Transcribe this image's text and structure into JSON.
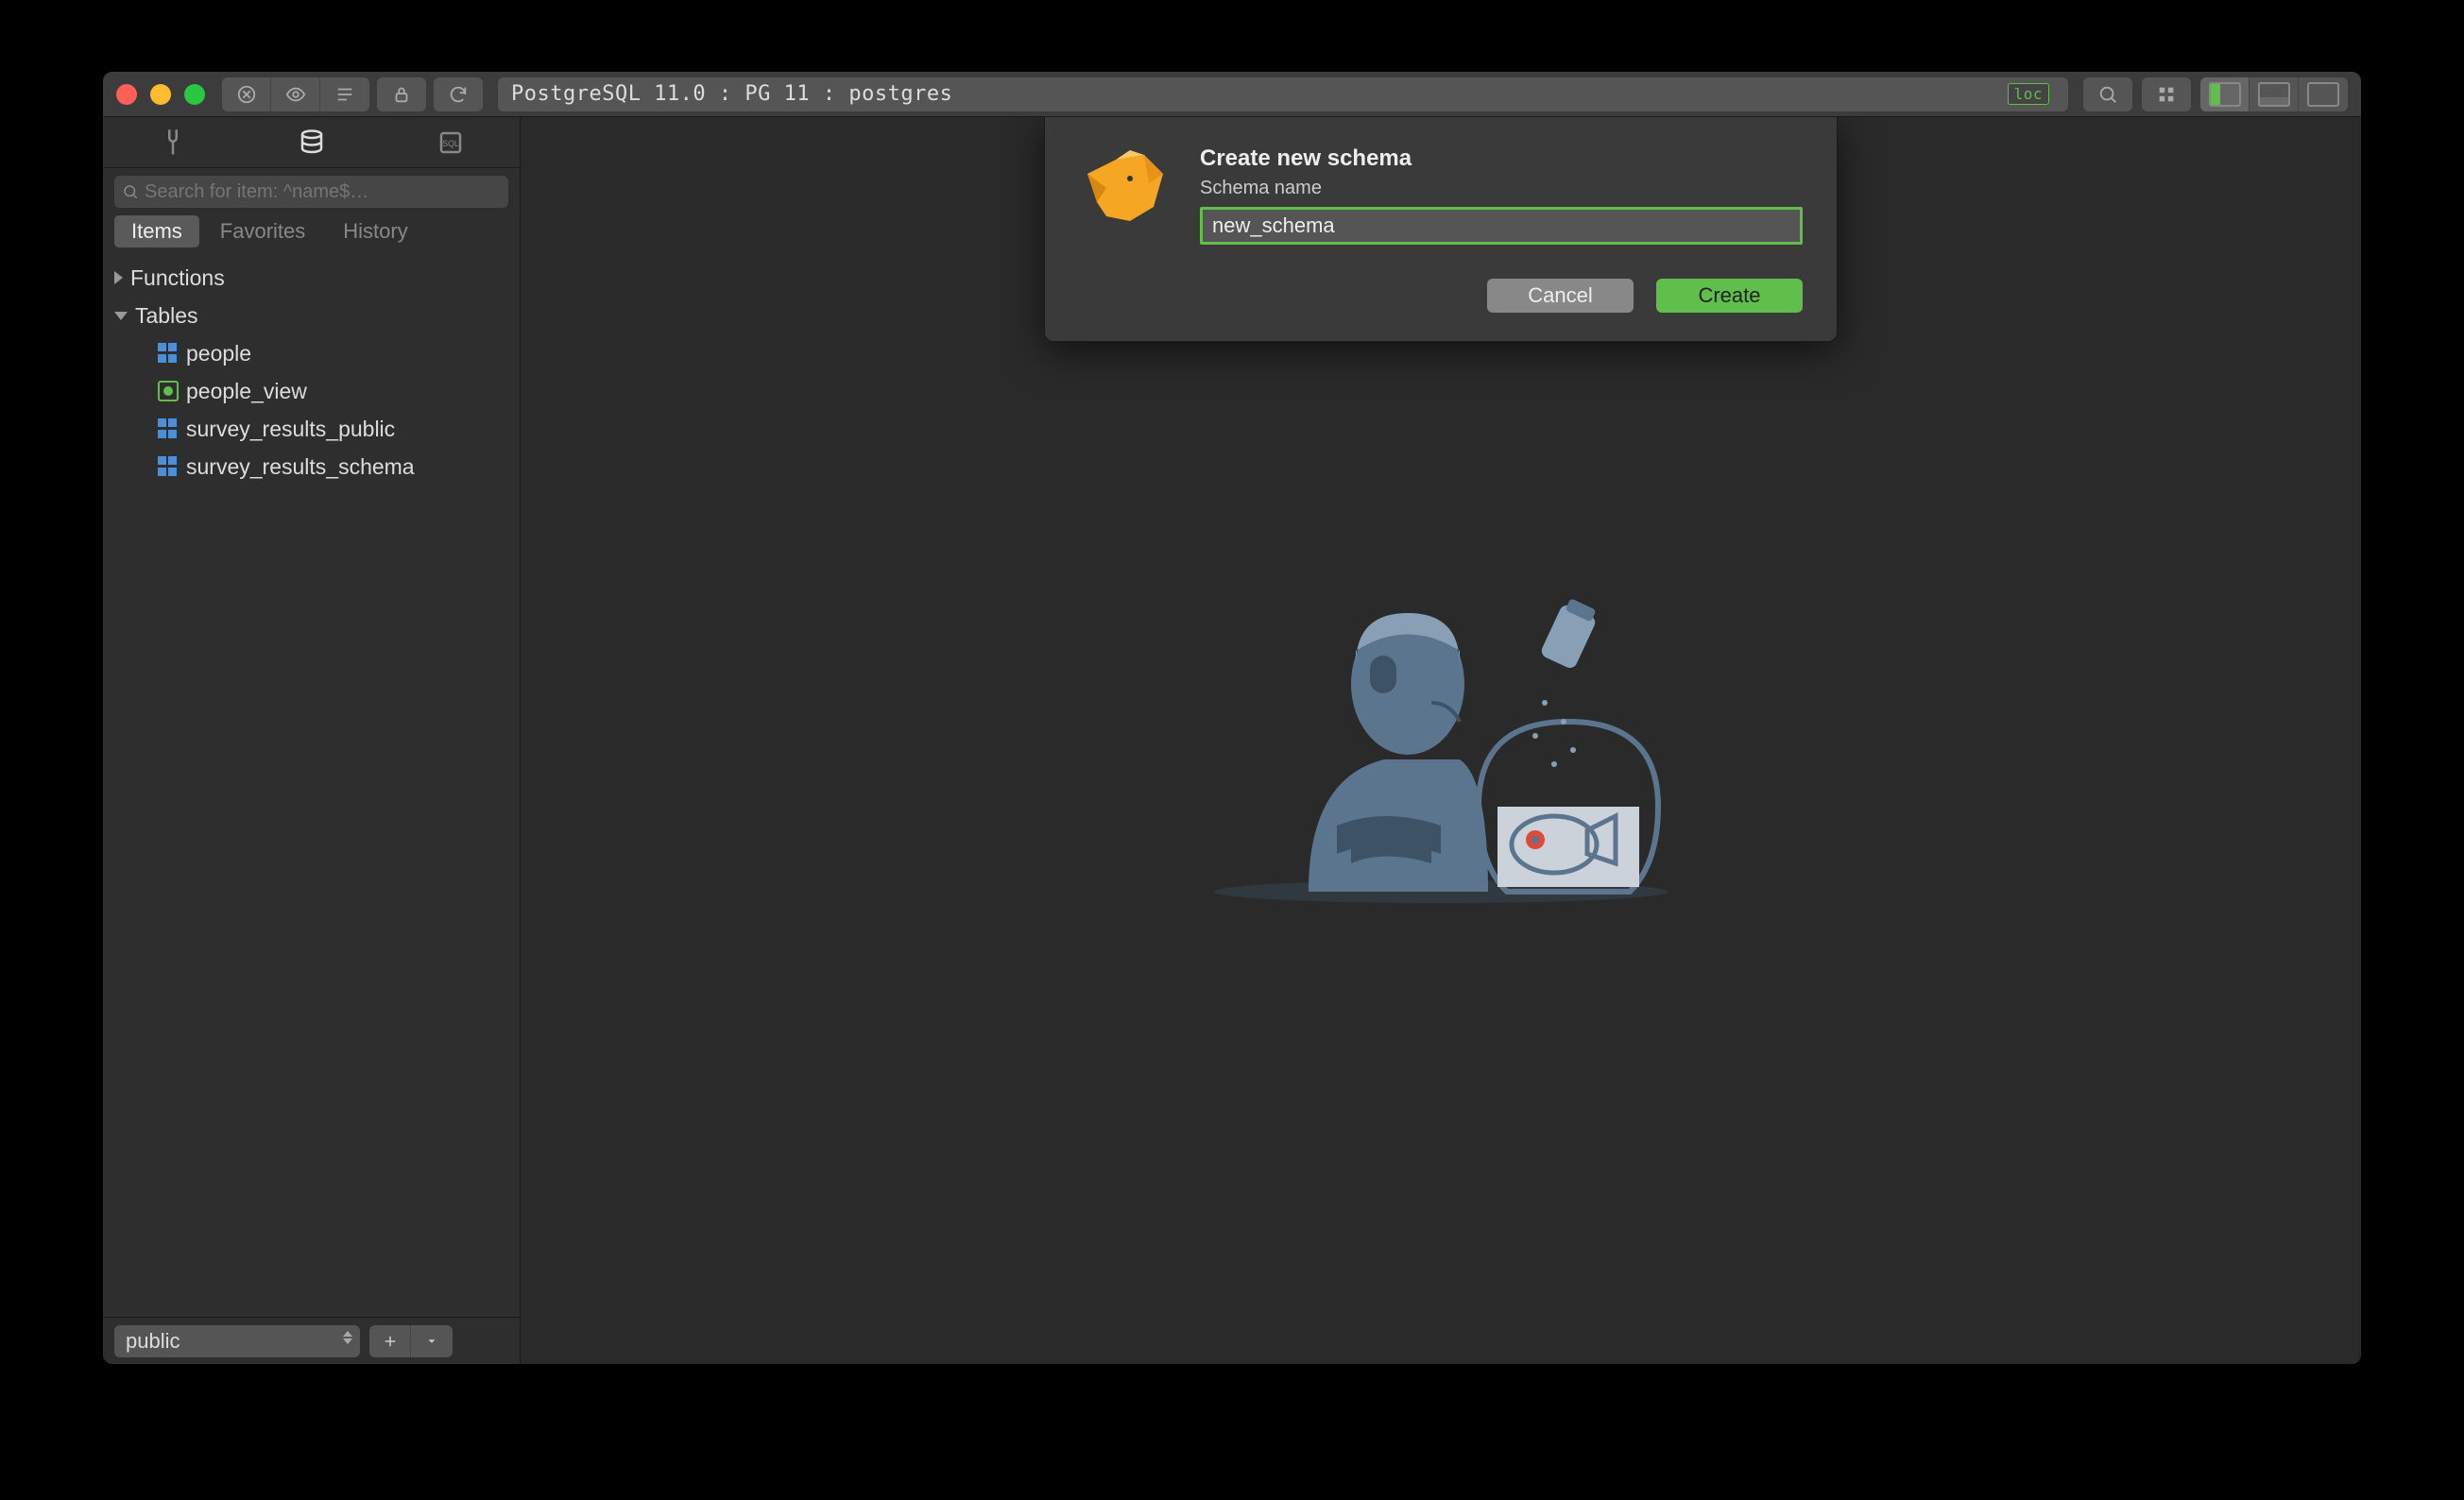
{
  "breadcrumb": "PostgreSQL 11.0 : PG 11 : postgres",
  "loc_badge": "loc",
  "search_placeholder": "Search for item: ^name$…",
  "segments": {
    "items": "Items",
    "favorites": "Favorites",
    "history": "History"
  },
  "tree": {
    "functions": "Functions",
    "tables": "Tables",
    "items": [
      {
        "name": "people",
        "kind": "table"
      },
      {
        "name": "people_view",
        "kind": "view"
      },
      {
        "name": "survey_results_public",
        "kind": "table"
      },
      {
        "name": "survey_results_schema",
        "kind": "table"
      }
    ]
  },
  "schema_selector": "public",
  "dialog": {
    "title": "Create new schema",
    "label": "Schema name",
    "value": "new_schema",
    "cancel": "Cancel",
    "create": "Create"
  }
}
